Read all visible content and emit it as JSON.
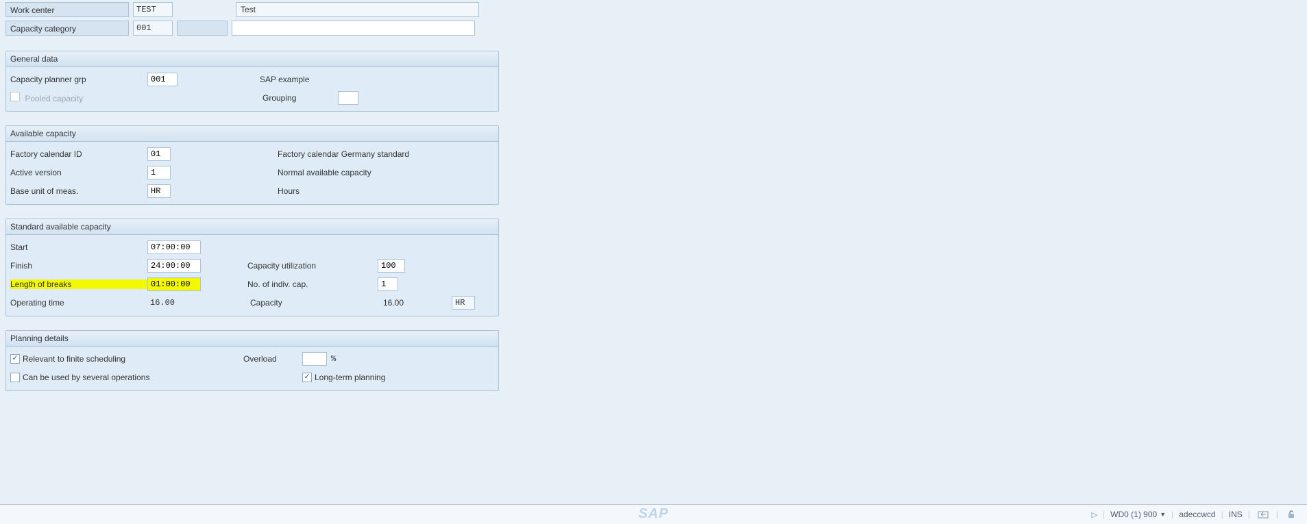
{
  "header": {
    "work_center_label": "Work center",
    "work_center_value": "TEST",
    "work_center_desc": "Test",
    "capacity_category_label": "Capacity category",
    "capacity_category_value": "001",
    "capacity_category_extra": "",
    "capacity_category_desc": ""
  },
  "general": {
    "title": "General data",
    "planner_grp_label": "Capacity planner grp",
    "planner_grp_value": "001",
    "planner_grp_text": "SAP example",
    "pooled_label": "Pooled capacity",
    "grouping_label": "Grouping",
    "grouping_value": ""
  },
  "available": {
    "title": "Available capacity",
    "factory_cal_label": "Factory calendar ID",
    "factory_cal_value": "01",
    "factory_cal_text": "Factory calendar Germany standard",
    "active_version_label": "Active version",
    "active_version_value": "1",
    "active_version_text": "Normal available capacity",
    "base_uom_label": "Base unit of meas.",
    "base_uom_value": "HR",
    "base_uom_text": "Hours"
  },
  "standard": {
    "title": "Standard available capacity",
    "start_label": "Start",
    "start_value": "07:00:00",
    "finish_label": "Finish",
    "finish_value": "24:00:00",
    "util_label": "Capacity utilization",
    "util_value": "100",
    "breaks_label": "Length of breaks",
    "breaks_value": "01:00:00",
    "indiv_label": "No. of indiv. cap.",
    "indiv_value": "1",
    "optime_label": "Operating time",
    "optime_value": "16.00",
    "capacity_label": "Capacity",
    "capacity_value": "16.00",
    "capacity_uom": "HR"
  },
  "planning": {
    "title": "Planning details",
    "finite_label": "Relevant to finite scheduling",
    "finite_checked": true,
    "overload_label": "Overload",
    "overload_value": "",
    "overload_suffix": "%",
    "several_ops_label": "Can be used by several operations",
    "several_ops_checked": false,
    "longterm_label": "Long-term planning",
    "longterm_checked": true
  },
  "status": {
    "system": "WD0 (1) 900",
    "server": "adeccwcd",
    "mode": "INS"
  }
}
